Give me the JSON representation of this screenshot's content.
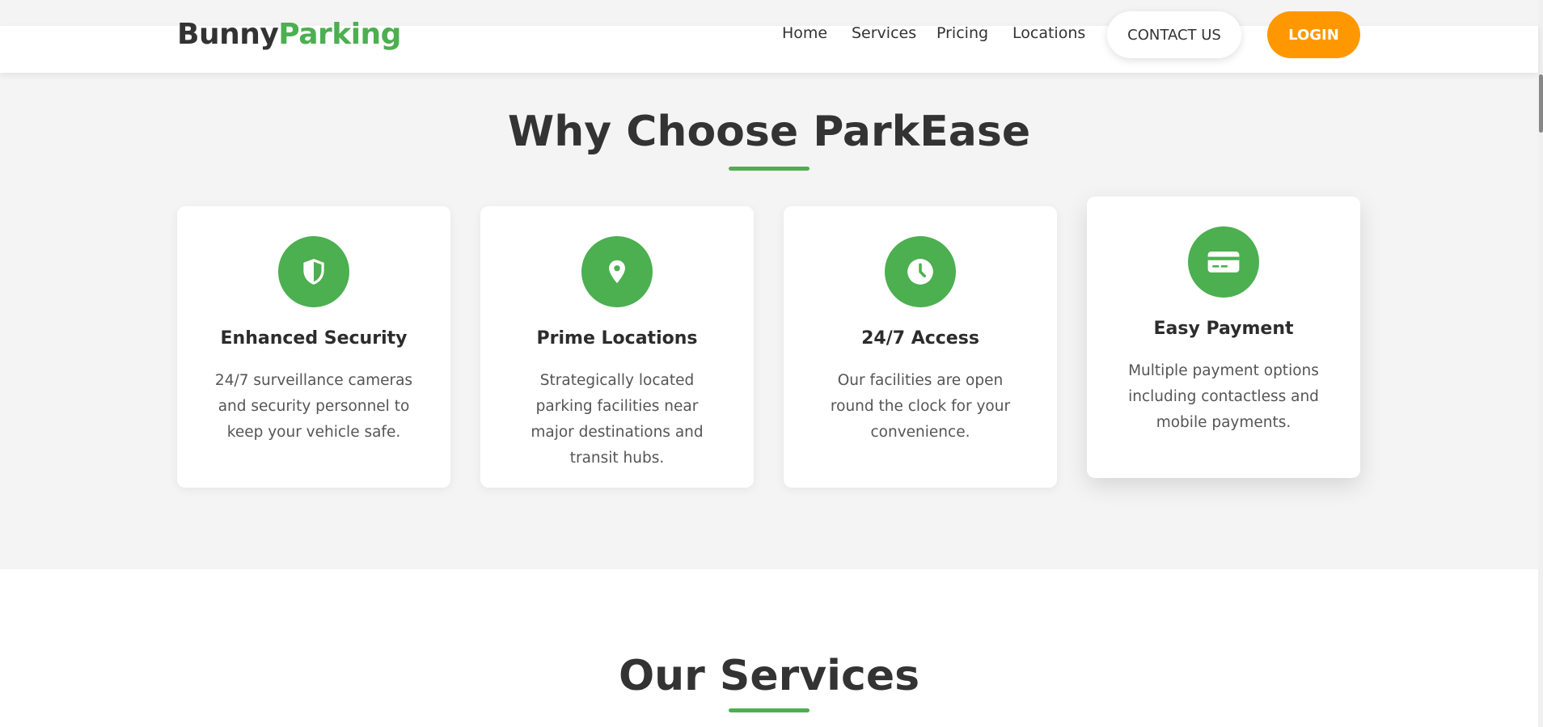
{
  "header": {
    "logo_part1": "Bunny",
    "logo_part2": "Parking",
    "nav": [
      "Home",
      "Services",
      "Pricing",
      "Locations"
    ],
    "contact_label": "CONTACT US",
    "login_label": "LOGIN"
  },
  "why": {
    "title": "Why Choose ParkEase",
    "cards": [
      {
        "icon": "shield-icon",
        "title": "Enhanced Security",
        "desc": "24/7 surveillance cameras and security personnel to keep your vehicle safe."
      },
      {
        "icon": "map-pin-icon",
        "title": "Prime Locations",
        "desc": "Strategically located parking facilities near major destinations and transit hubs."
      },
      {
        "icon": "clock-icon",
        "title": "24/7 Access",
        "desc": "Our facilities are open round the clock for your convenience."
      },
      {
        "icon": "credit-card-icon",
        "title": "Easy Payment",
        "desc": "Multiple payment options including contactless and mobile payments."
      }
    ]
  },
  "services": {
    "title": "Our Services"
  },
  "colors": {
    "accent_green": "#4caf50",
    "login_orange": "#ff9800",
    "text_dark": "#333333"
  }
}
